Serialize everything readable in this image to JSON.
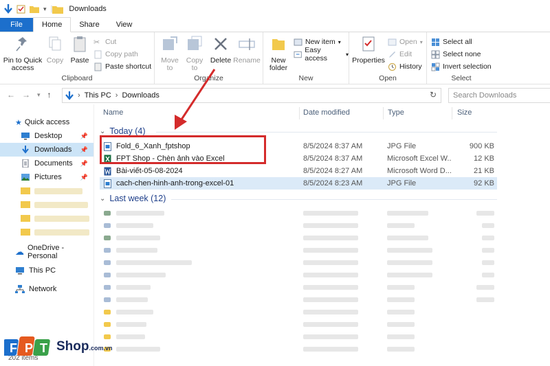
{
  "window": {
    "title": "Downloads"
  },
  "tabs": [
    {
      "label": "File"
    },
    {
      "label": "Home"
    },
    {
      "label": "Share"
    },
    {
      "label": "View"
    }
  ],
  "ribbon": {
    "clipboard": {
      "label": "Clipboard",
      "pin": "Pin to Quick access",
      "copy": "Copy",
      "paste": "Paste",
      "cut": "Cut",
      "copy_path": "Copy path",
      "paste_shortcut": "Paste shortcut"
    },
    "organize": {
      "label": "Organize",
      "move_to": "Move to",
      "copy_to": "Copy to",
      "delete": "Delete",
      "rename": "Rename"
    },
    "new": {
      "label": "New",
      "new_folder": "New folder",
      "new_item": "New item",
      "easy_access": "Easy access"
    },
    "open": {
      "label": "Open",
      "properties": "Properties",
      "open": "Open",
      "edit": "Edit",
      "history": "History"
    },
    "select": {
      "label": "Select",
      "select_all": "Select all",
      "select_none": "Select none",
      "invert": "Invert selection"
    }
  },
  "address": {
    "crumbs": [
      "This PC",
      "Downloads"
    ],
    "search_placeholder": "Search Downloads"
  },
  "sidebar": {
    "quick_access": "Quick access",
    "items": [
      {
        "label": "Desktop"
      },
      {
        "label": "Downloads"
      },
      {
        "label": "Documents"
      },
      {
        "label": "Pictures"
      }
    ],
    "onedrive": "OneDrive - Personal",
    "this_pc": "This PC",
    "network": "Network"
  },
  "columns": {
    "name": "Name",
    "date": "Date modified",
    "type": "Type",
    "size": "Size"
  },
  "groups": {
    "today": "Today (4)",
    "last_week": "Last week (12)"
  },
  "files": [
    {
      "name": "Fold_6_Xanh_fptshop",
      "date": "8/5/2024 8:37 AM",
      "type": "JPG File",
      "size": "900 KB",
      "icon": "jpg"
    },
    {
      "name": "FPT Shop - Chèn ảnh vào Excel",
      "date": "8/5/2024 8:37 AM",
      "type": "Microsoft Excel W...",
      "size": "12 KB",
      "icon": "excel"
    },
    {
      "name": "Bài-viết-05-08-2024",
      "date": "8/5/2024 8:27 AM",
      "type": "Microsoft Word D...",
      "size": "21 KB",
      "icon": "word"
    },
    {
      "name": "cach-chen-hinh-anh-trong-excel-01",
      "date": "8/5/2024 8:23 AM",
      "type": "JPG File",
      "size": "92 KB",
      "icon": "jpg"
    }
  ],
  "status": {
    "count": "202 items"
  },
  "brand": {
    "logo_text": "FPT Shop.com.vn",
    "accent": "#d42b2b",
    "blue": "#1c6fcc"
  }
}
